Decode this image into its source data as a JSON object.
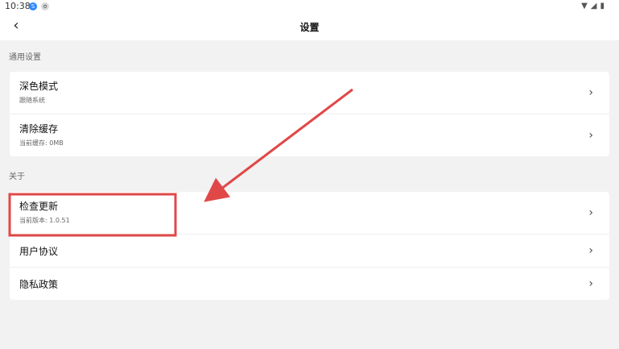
{
  "status_bar": {
    "time": "10:38",
    "icon_one": "S",
    "icon_two": "ʊ",
    "wifi_icon": "wifi",
    "signal_icon": "signal",
    "battery_icon": "battery"
  },
  "header": {
    "back_icon": "‹",
    "title": "设置"
  },
  "sections": {
    "general": {
      "label": "通用设置",
      "items": [
        {
          "title": "深色模式",
          "subtitle": "跟随系统"
        },
        {
          "title": "清除缓存",
          "subtitle": "当前缓存: 0MB"
        }
      ]
    },
    "about": {
      "label": "关于",
      "items": [
        {
          "title": "检查更新",
          "subtitle": "当前版本: 1.0.51"
        },
        {
          "title": "用户协议"
        },
        {
          "title": "隐私政策"
        }
      ]
    }
  },
  "annotation": {
    "highlight_color": "#e04848",
    "arrow_color": "#e04848"
  }
}
